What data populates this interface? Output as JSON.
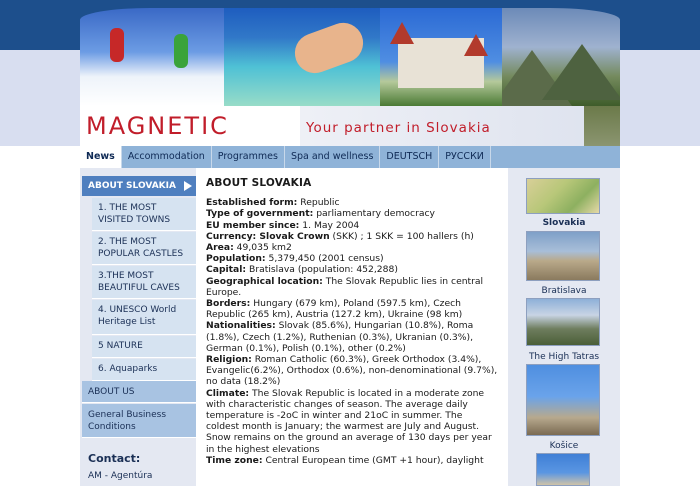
{
  "header": {
    "brand": "MAGNETIC",
    "tagline": "Your partner in Slovakia"
  },
  "nav": {
    "items": [
      {
        "label": "News",
        "active": true
      },
      {
        "label": "Accommodation"
      },
      {
        "label": "Programmes"
      },
      {
        "label": "Spa and wellness"
      },
      {
        "label": "DEUTSCH"
      },
      {
        "label": "РУССКИ"
      }
    ]
  },
  "sidebar": {
    "heading": "ABOUT SLOVAKIA",
    "sub_items": [
      "1. THE MOST VISITED TOWNS",
      "2. THE MOST POPULAR CASTLES",
      "3.THE MOST BEAUTIFUL CAVES",
      "4. UNESCO World Heritage List",
      "5 NATURE",
      "6. Aquaparks"
    ],
    "main_items": [
      "ABOUT US",
      "General Business Conditions"
    ],
    "contact_title": "Contact:",
    "contact_line": "AM - Agentúra"
  },
  "content": {
    "title": "ABOUT SLOVAKIA",
    "rows": [
      {
        "label": "Established form:",
        "text": " Republic"
      },
      {
        "label": "Type of government:",
        "text": " parliamentary democracy"
      },
      {
        "label": "EU member since:",
        "text": " 1. May 2004"
      },
      {
        "label": "Currency: Slovak Crown",
        "text": " (SKK) ; 1 SKK = 100 hallers (h)"
      },
      {
        "label": "Area:",
        "text": " 49,035 km2"
      },
      {
        "label": "Population:",
        "text": " 5,379,450 (2001 census)"
      },
      {
        "label": "Capital:",
        "text": " Bratislava (population: 452,288)"
      },
      {
        "label": "Geographical location:",
        "text": " The Slovak Republic lies in central Europe."
      },
      {
        "label": "Borders:",
        "text": " Hungary (679 km), Poland (597.5 km), Czech Republic (265 km), Austria (127.2 km), Ukraine (98 km)"
      },
      {
        "label": "Nationalities:",
        "text": " Slovak (85.6%), Hungarian (10.8%), Roma (1.8%), Czech (1.2%), Ruthenian (0.3%), Ukranian (0.3%), German (0.1%), Polish (0.1%), other (0.2%)"
      },
      {
        "label": "Religion:",
        "text": " Roman Catholic (60.3%), Greek Orthodox (3.4%), Evangelic(6.2%), Orthodox (0.6%), non-denominational (9.7%), no data (18.2%)"
      },
      {
        "label": "Climate:",
        "text": " The Slovak Republic is located in a moderate zone with characteristic changes of season. The average daily temperature is -2oC in winter and 21oC in summer. The coldest month is January; the warmest are July and August. Snow remains on the ground an average of 130 days per year in the highest elevations"
      },
      {
        "label": "Time zone:",
        "text": " Central European time (GMT +1 hour), daylight"
      }
    ]
  },
  "right": {
    "captions": [
      "Slovakia",
      "Bratislava",
      "The High Tatras",
      "Košice"
    ]
  }
}
